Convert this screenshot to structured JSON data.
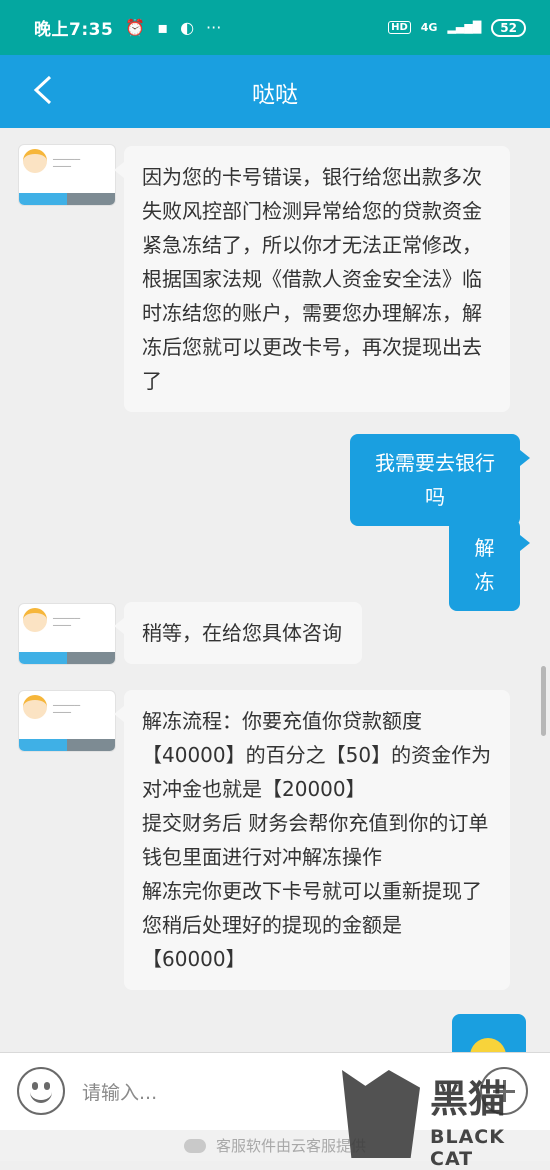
{
  "status_bar": {
    "time": "晚上7:35",
    "network": "4G",
    "hd_label": "HD",
    "battery": "52",
    "icons": [
      "alarm-icon",
      "message-icon",
      "wechat-icon",
      "more-dots-icon",
      "signal-icon"
    ]
  },
  "header": {
    "title": "哒哒",
    "back_icon": "chevron-left-icon",
    "bg_color": "#1a9fe0"
  },
  "messages": [
    {
      "side": "left",
      "text": "因为您的卡号错误，银行给您出款多次失败风控部门检测异常给您的贷款资金紧急冻结了，所以你才无法正常修改，根据国家法规《借款人资金安全法》临时冻结您的账户，需要您办理解冻，解冻后您就可以更改卡号，再次提现出去了"
    },
    {
      "side": "right",
      "text": "我需要去银行吗"
    },
    {
      "side": "right",
      "text": "解冻"
    },
    {
      "side": "left",
      "text": "稍等，在给您具体咨询"
    },
    {
      "side": "left",
      "text": "解冻流程：你要充值你贷款额度【40000】的百分之【50】的资金作为对冲金也就是【20000】\n提交财务后 财务会帮你充值到你的订单钱包里面进行对冲解冻操作\n解冻完你更改下卡号就可以重新提现了您稍后处理好的提现的金额是【60000】"
    },
    {
      "side": "right",
      "emoji": "emoji-face-icon"
    }
  ],
  "input": {
    "placeholder": "请输入..."
  },
  "footer": {
    "text": "客服软件由云客服提供"
  },
  "watermark": {
    "text_cn": "黑猫",
    "text_en": "BLACK CAT"
  },
  "colors": {
    "status_bar": "#04a7a0",
    "accent": "#1a9fe0",
    "chat_bg": "#efefef"
  }
}
